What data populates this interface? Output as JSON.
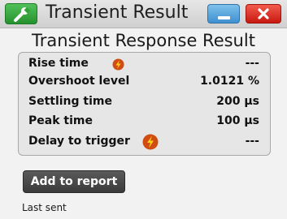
{
  "window": {
    "title": "Transient Result",
    "icons": {
      "app": "wrench-icon",
      "minimize": "minimize-icon",
      "close": "close-icon"
    },
    "colors": {
      "app_button": "#2fa236",
      "minimize_button": "#4f9fdc",
      "close_button": "#de2d20"
    }
  },
  "header": {
    "title": "Transient Response Result"
  },
  "results": {
    "rows": [
      {
        "label": "Rise time",
        "value": "---",
        "warning": true
      },
      {
        "label": "Overshoot level",
        "value": "1.0121 %",
        "warning": false
      },
      {
        "label": "Settling time",
        "value": "200 µs",
        "warning": false
      },
      {
        "label": "Peak time",
        "value": "100 µs",
        "warning": false
      },
      {
        "label": "Delay to trigger",
        "value": "---",
        "warning": true
      }
    ],
    "warning_icon": "lightning-warning-icon"
  },
  "actions": {
    "add_to_report_label": "Add to report"
  },
  "status": {
    "last_sent_label": "Last sent"
  }
}
